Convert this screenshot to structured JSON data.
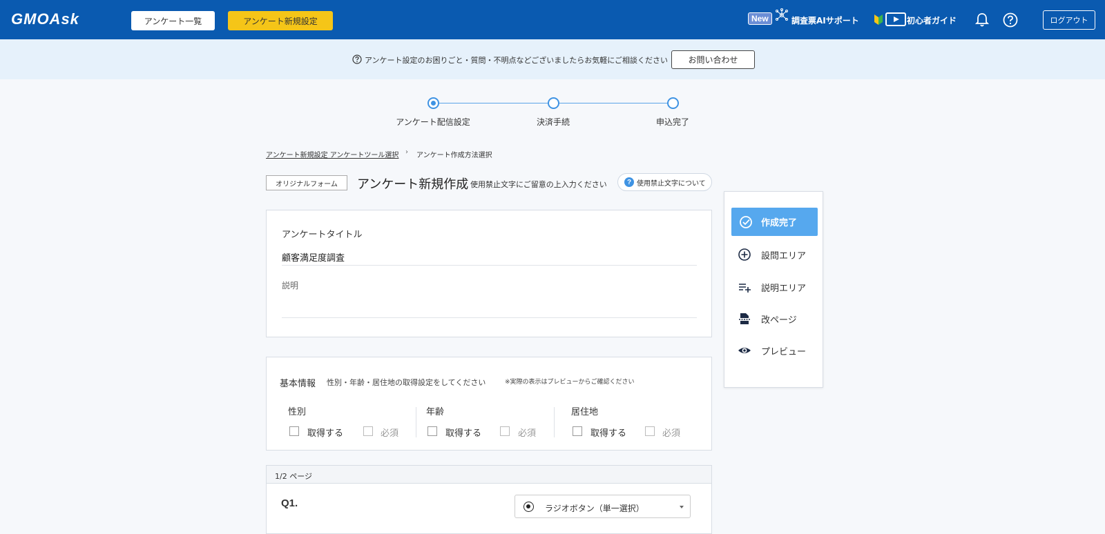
{
  "header": {
    "logo": "GMOAsk",
    "survey_list": "アンケート一覧",
    "new_survey": "アンケート新規設定",
    "new_badge": "New",
    "ai_support": "調査票AIサポート",
    "beginner_guide": "初心者ガイド",
    "logout": "ログアウト"
  },
  "infobar": {
    "text": "アンケート設定のお困りごと・質問・不明点などございましたらお気軽にご相談ください",
    "contact": "お問い合わせ"
  },
  "stepper": {
    "steps": [
      "アンケート配信設定",
      "決済手続",
      "申込完了"
    ],
    "active_index": 0
  },
  "breadcrumb": {
    "link": "アンケート新規設定 アンケートツール選択",
    "separator": "›",
    "current": "アンケート作成方法選択"
  },
  "title_row": {
    "tag": "オリジナルフォーム",
    "heading": "アンケート新規作成",
    "note": "使用禁止文字にご留意の上入力ください",
    "banned_button": "使用禁止文字について"
  },
  "survey_card": {
    "title_label": "アンケートタイトル",
    "title_value": "顧客満足度調査",
    "description_placeholder": "説明"
  },
  "basic_info": {
    "title": "基本情報",
    "subtitle": "性別・年齢・居住地の取得設定をしてください",
    "note": "※実際の表示はプレビューからご確認ください",
    "groups": [
      {
        "name": "性別",
        "acquire": "取得する",
        "required": "必須"
      },
      {
        "name": "年齢",
        "acquire": "取得する",
        "required": "必須"
      },
      {
        "name": "居住地",
        "acquire": "取得する",
        "required": "必須"
      }
    ]
  },
  "question_card": {
    "page": "1/2 ページ",
    "question_no": "Q1.",
    "question_type": "ラジオボタン（単一選択）"
  },
  "side_panel": {
    "done": "作成完了",
    "items": [
      "設問エリア",
      "説明エリア",
      "改ページ",
      "プレビュー"
    ]
  },
  "colors": {
    "header_bg": "#0a5ab0",
    "accent_yellow": "#f5c518",
    "primary_blue": "#56a8ee",
    "info_bg": "#e6f1fb"
  }
}
